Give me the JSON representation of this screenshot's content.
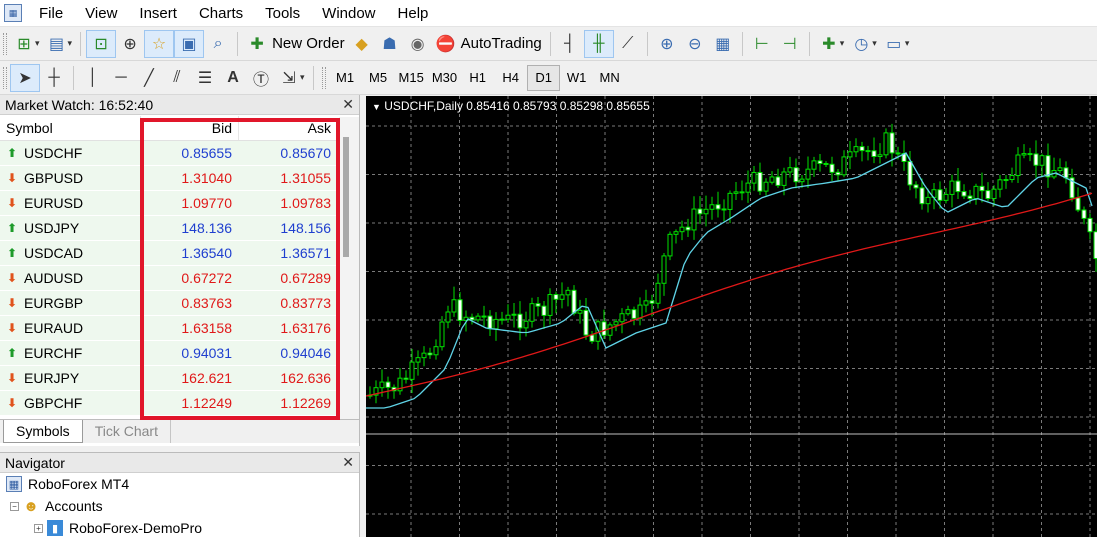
{
  "menu": [
    "File",
    "View",
    "Insert",
    "Charts",
    "Tools",
    "Window",
    "Help"
  ],
  "toolbar": {
    "new_order": "New Order",
    "autotrading": "AutoTrading"
  },
  "timeframes": [
    "M1",
    "M5",
    "M15",
    "M30",
    "H1",
    "H4",
    "D1",
    "W1",
    "MN"
  ],
  "active_timeframe": "D1",
  "market_watch": {
    "title": "Market Watch: 16:52:40",
    "headers": {
      "symbol": "Symbol",
      "bid": "Bid",
      "ask": "Ask"
    },
    "rows": [
      {
        "symbol": "USDCHF",
        "bid": "0.85655",
        "ask": "0.85670",
        "dir": "up"
      },
      {
        "symbol": "GBPUSD",
        "bid": "1.31040",
        "ask": "1.31055",
        "dir": "down"
      },
      {
        "symbol": "EURUSD",
        "bid": "1.09770",
        "ask": "1.09783",
        "dir": "down"
      },
      {
        "symbol": "USDJPY",
        "bid": "148.136",
        "ask": "148.156",
        "dir": "up"
      },
      {
        "symbol": "USDCAD",
        "bid": "1.36540",
        "ask": "1.36571",
        "dir": "up"
      },
      {
        "symbol": "AUDUSD",
        "bid": "0.67272",
        "ask": "0.67289",
        "dir": "down"
      },
      {
        "symbol": "EURGBP",
        "bid": "0.83763",
        "ask": "0.83773",
        "dir": "down"
      },
      {
        "symbol": "EURAUD",
        "bid": "1.63158",
        "ask": "1.63176",
        "dir": "down"
      },
      {
        "symbol": "EURCHF",
        "bid": "0.94031",
        "ask": "0.94046",
        "dir": "up"
      },
      {
        "symbol": "EURJPY",
        "bid": "162.621",
        "ask": "162.636",
        "dir": "down"
      },
      {
        "symbol": "GBPCHF",
        "bid": "1.12249",
        "ask": "1.12269",
        "dir": "down"
      }
    ],
    "tabs": [
      "Symbols",
      "Tick Chart"
    ]
  },
  "navigator": {
    "title": "Navigator",
    "items": [
      "RoboForex MT4",
      "Accounts",
      "RoboForex-DemoPro"
    ]
  },
  "chart": {
    "title": "USDCHF,Daily  0.85416 0.85793 0.85298 0.85655",
    "colors": {
      "bull": "#00e000",
      "bear": "#ffffff",
      "ma_fast": "#5fd3e6",
      "ma_slow": "#e01818",
      "grid": "#7a7a7a"
    }
  },
  "colors": {
    "up": "#1d9b2a",
    "down": "#e0531c",
    "highlight": "#e1162a"
  }
}
